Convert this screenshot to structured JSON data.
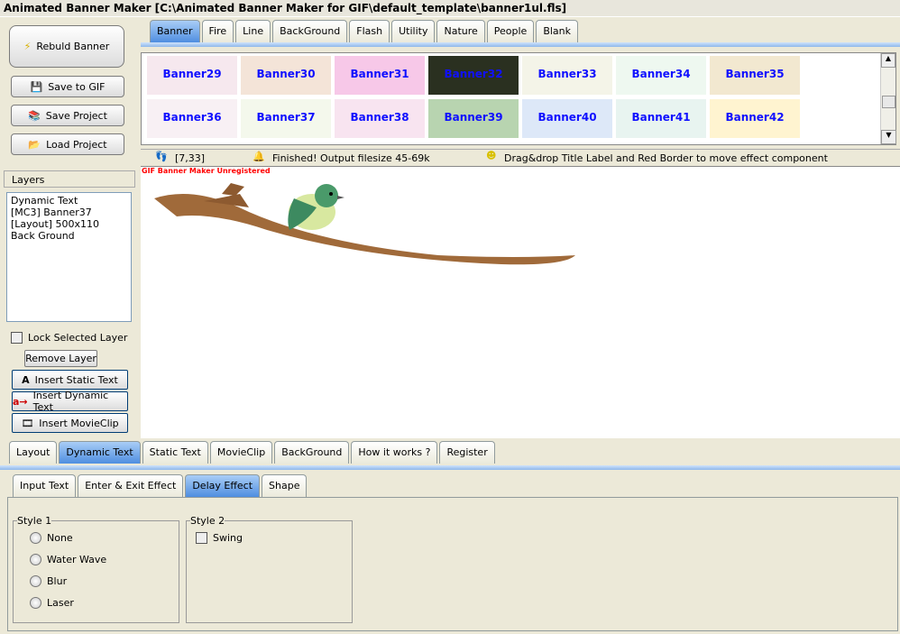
{
  "window": {
    "title": "Animated Banner Maker [C:\\Animated Banner Maker for GIF\\default_template\\banner1ul.fls]"
  },
  "left": {
    "rebuild": "Rebuld Banner",
    "save_gif": "Save to GIF",
    "save_project": "Save Project",
    "load_project": "Load Project",
    "layers_label": "Layers",
    "layers": [
      "Dynamic Text",
      "[MC3] Banner37",
      "[Layout] 500x110",
      "Back Ground"
    ],
    "lock": "Lock Selected Layer",
    "remove": "Remove Layer",
    "insert_static": "Insert Static Text",
    "insert_dynamic": "Insert Dynamic Text",
    "insert_movieclip": "Insert MovieClip"
  },
  "top_tabs": [
    "Banner",
    "Fire",
    "Line",
    "BackGround",
    "Flash",
    "Utility",
    "Nature",
    "People",
    "Blank"
  ],
  "thumbnails": [
    {
      "label": "Banner29",
      "color": "#f6e8ee"
    },
    {
      "label": "Banner30",
      "color": "#f4e4d8"
    },
    {
      "label": "Banner31",
      "color": "#f7c8e8"
    },
    {
      "label": "Banner32",
      "color": "#2a3020"
    },
    {
      "label": "Banner33",
      "color": "#f4f4e8"
    },
    {
      "label": "Banner34",
      "color": "#eef8f0"
    },
    {
      "label": "Banner35",
      "color": "#f2e8d0"
    },
    {
      "label": "Banner36",
      "color": "#f8f0f4"
    },
    {
      "label": "Banner37",
      "color": "#f4f8ec"
    },
    {
      "label": "Banner38",
      "color": "#f8e4f0"
    },
    {
      "label": "Banner39",
      "color": "#b8d4b0"
    },
    {
      "label": "Banner40",
      "color": "#dde8f8"
    },
    {
      "label": "Banner41",
      "color": "#e8f4f0"
    },
    {
      "label": "Banner42",
      "color": "#fff4d0"
    }
  ],
  "status": {
    "coords": "[7,33]",
    "message": "Finished! Output filesize 45-69k",
    "hint": "Drag&drop Title Label and Red Border to move effect component"
  },
  "canvas": {
    "watermark": "GIF Banner Maker Unregistered"
  },
  "bottom_tabs": [
    "Layout",
    "Dynamic Text",
    "Static Text",
    "MovieClip",
    "BackGround",
    "How it works ?",
    "Register"
  ],
  "sub_tabs": [
    "Input Text",
    "Enter & Exit Effect",
    "Delay Effect",
    "Shape"
  ],
  "style1": {
    "label": "Style 1",
    "options": [
      "None",
      "Water Wave",
      "Blur",
      "Laser"
    ]
  },
  "style2": {
    "label": "Style 2",
    "options": [
      "Swing"
    ]
  }
}
